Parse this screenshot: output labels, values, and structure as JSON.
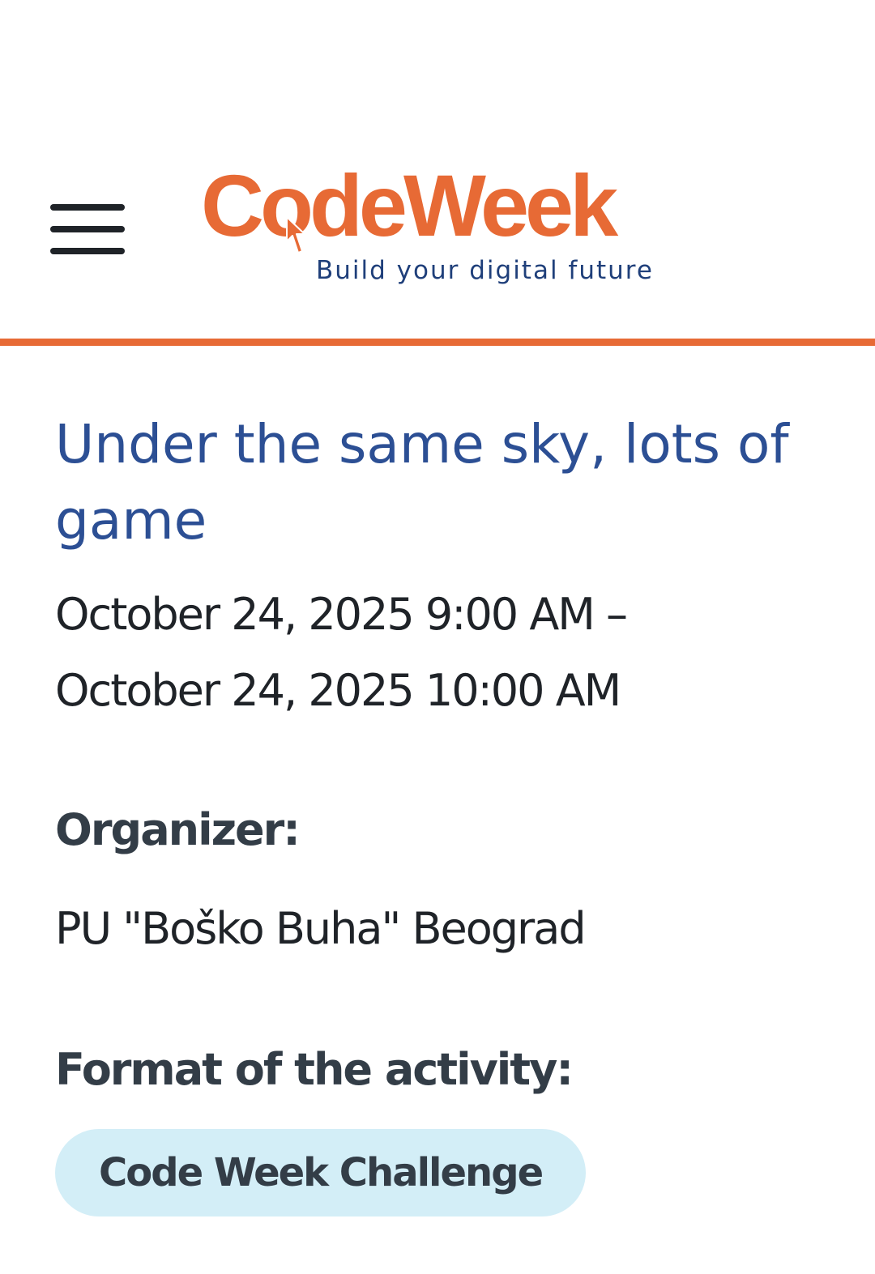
{
  "header": {
    "menu_icon": "hamburger-menu-icon",
    "logo": {
      "wordmark": "CodeWeek",
      "tagline": "Build your digital future",
      "brand_color": "#e76a35",
      "tagline_color": "#1f3f7a"
    },
    "divider_color": "#e76a35"
  },
  "event": {
    "title": "Under the same sky, lots of game",
    "date_start": "October 24, 2025 9:00 AM –",
    "date_end": "October 24, 2025 10:00 AM",
    "organizer_label": "Organizer:",
    "organizer_value": "PU \"Boško Buha\" Beograd",
    "format_label": "Format of the activity:",
    "format_tags": [
      "Code Week Challenge"
    ],
    "title_color": "#2c4f94",
    "tag_background": "#d3eef7"
  }
}
